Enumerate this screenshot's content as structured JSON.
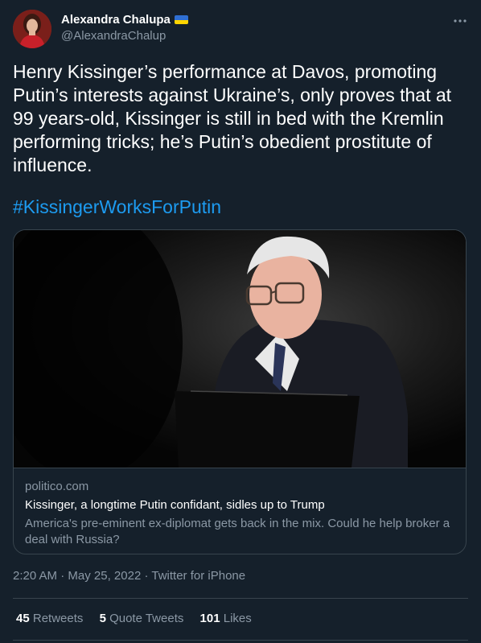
{
  "author": {
    "display_name": "Alexandra Chalupa",
    "handle": "@AlexandraChalup"
  },
  "tweet": {
    "text": "Henry Kissinger’s performance at Davos, promoting Putin’s interests against Ukraine’s, only proves that at 99 years-old, Kissinger is still in bed with the Kremlin performing tricks; he’s Putin’s obedient prostitute of influence.",
    "hashtag": "#KissingerWorksForPutin"
  },
  "card": {
    "domain": "politico.com",
    "title": "Kissinger, a longtime Putin confidant, sidles up to Trump",
    "description": "America's pre-eminent ex-diplomat gets back in the mix. Could he help broker a deal with Russia?"
  },
  "meta": {
    "time": "2:20 AM",
    "date": "May 25, 2022",
    "source": "Twitter for iPhone",
    "separator": "·"
  },
  "stats": [
    {
      "count": "45",
      "label": "Retweets"
    },
    {
      "count": "5",
      "label": "Quote Tweets"
    },
    {
      "count": "101",
      "label": "Likes"
    }
  ],
  "colors": {
    "background": "#15202b",
    "accent": "#1d9bf0",
    "muted": "#8b98a5",
    "border": "#38444d"
  },
  "icons": {
    "more": "more-icon",
    "verified_flag": "ukraine-flag-icon"
  }
}
